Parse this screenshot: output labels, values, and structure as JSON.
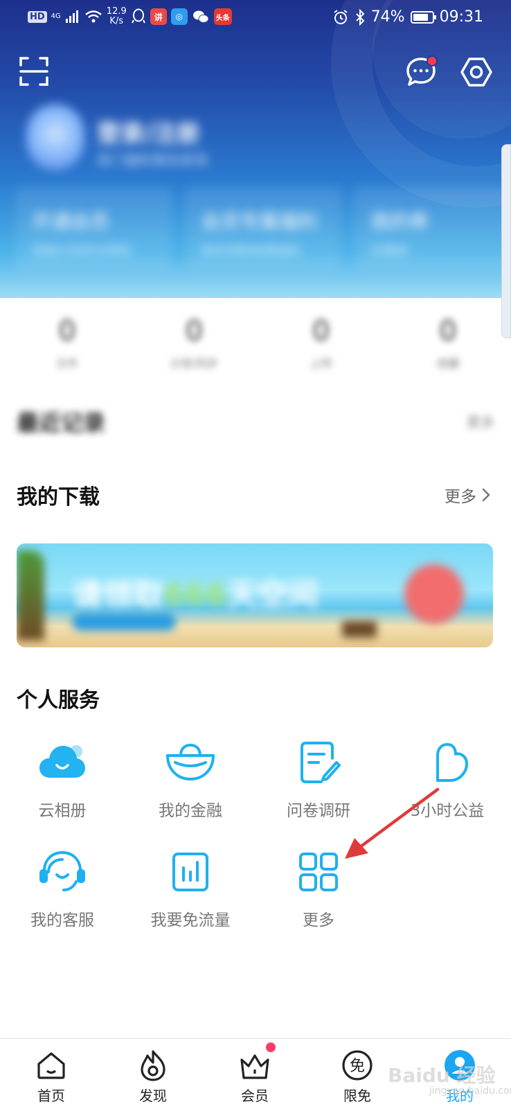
{
  "status_bar": {
    "hd": "HD",
    "net": "4G",
    "speed_value": "12.9",
    "speed_unit": "K/s",
    "app_badge_1": "讲",
    "app_badge_2": "头条",
    "battery": "74%",
    "time": "09:31"
  },
  "header": {
    "user_name": "登录/注册",
    "user_sub": "热门福利等你来领",
    "promos": [
      {
        "title": "开通会员",
        "sub": "享超大空间与特权"
      },
      {
        "title": "会员专属福利",
        "sub": "每月领取免费福利"
      },
      {
        "title": "我的券",
        "sub": "优惠券"
      }
    ]
  },
  "stats": [
    {
      "value": "0",
      "label": "文件"
    },
    {
      "value": "0",
      "label": "分享/同步"
    },
    {
      "value": "0",
      "label": "上传"
    },
    {
      "value": "0",
      "label": "收藏"
    }
  ],
  "recent": {
    "title": "最近记录",
    "more": "更多"
  },
  "downloads": {
    "title": "我的下载",
    "more": "更多"
  },
  "banner": {
    "text_a": "请领取",
    "text_b": "666",
    "text_c": "天空间"
  },
  "services": {
    "title": "个人服务",
    "items": [
      {
        "label": "云相册",
        "icon": "cloud-icon"
      },
      {
        "label": "我的金融",
        "icon": "gold-ingot-icon"
      },
      {
        "label": "问卷调研",
        "icon": "survey-icon"
      },
      {
        "label": "3小时公益",
        "icon": "heart-icon"
      },
      {
        "label": "我的客服",
        "icon": "headset-icon"
      },
      {
        "label": "我要免流量",
        "icon": "chart-icon"
      },
      {
        "label": "更多",
        "icon": "grid-icon"
      }
    ]
  },
  "nav": [
    {
      "label": "首页",
      "icon": "home-icon"
    },
    {
      "label": "发现",
      "icon": "flame-icon"
    },
    {
      "label": "会员",
      "icon": "crown-icon"
    },
    {
      "label": "限免",
      "icon": "free-icon"
    },
    {
      "label": "我的",
      "icon": "profile-icon"
    }
  ],
  "watermark": {
    "main": "Baidu 经验",
    "sub": "jingyan.baidu.com"
  },
  "colors": {
    "accent": "#1aa6f0",
    "icon_blue": "#1fb0f0",
    "header_top": "#1d2f8c",
    "header_bottom": "#4db4ea",
    "alert_red": "#ff3b4b",
    "annotation": "#e03a3a"
  }
}
